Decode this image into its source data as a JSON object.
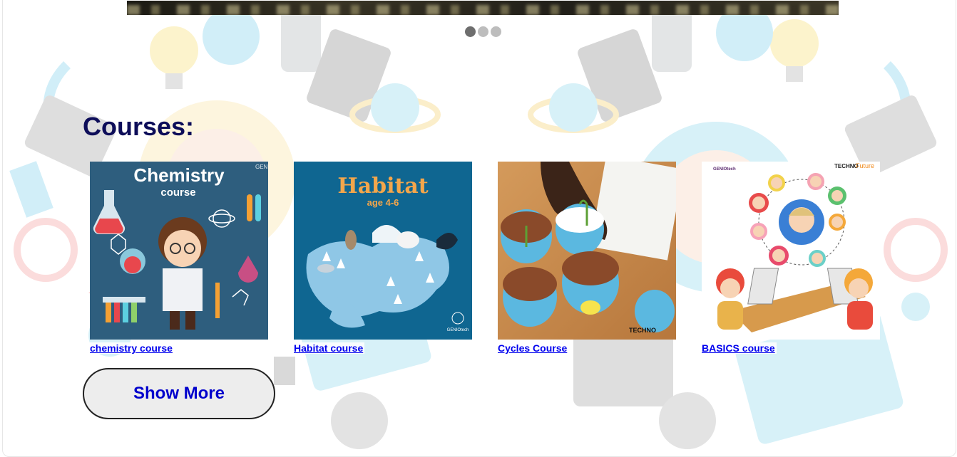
{
  "slider": {
    "dots": [
      {
        "active": true
      },
      {
        "active": false
      },
      {
        "active": false
      }
    ]
  },
  "courses": {
    "title": "Courses:",
    "items": [
      {
        "link": "chemistry course",
        "thumb_title": "Chemistry",
        "thumb_subtitle": "course",
        "thumb_brand": "GENI"
      },
      {
        "link": "Habitat course",
        "thumb_title": "Habitat",
        "thumb_subtitle": "age 4-6",
        "thumb_brand": "GENIOtech"
      },
      {
        "link": "Cycles Course",
        "thumb_brand": "TECHNO"
      },
      {
        "link": "BASICS course",
        "thumb_brand": "GENIOtech",
        "thumb_brand2": "TECHNO",
        "thumb_brand2_accent": "Future"
      }
    ],
    "show_more": "Show More"
  },
  "colors": {
    "title": "#0d0d59",
    "link": "#0000ee",
    "button_text": "#0000cc",
    "chem_bg": "#2e5e7e",
    "habitat_bg": "#0f6691",
    "habitat_title": "#f3a64b"
  }
}
